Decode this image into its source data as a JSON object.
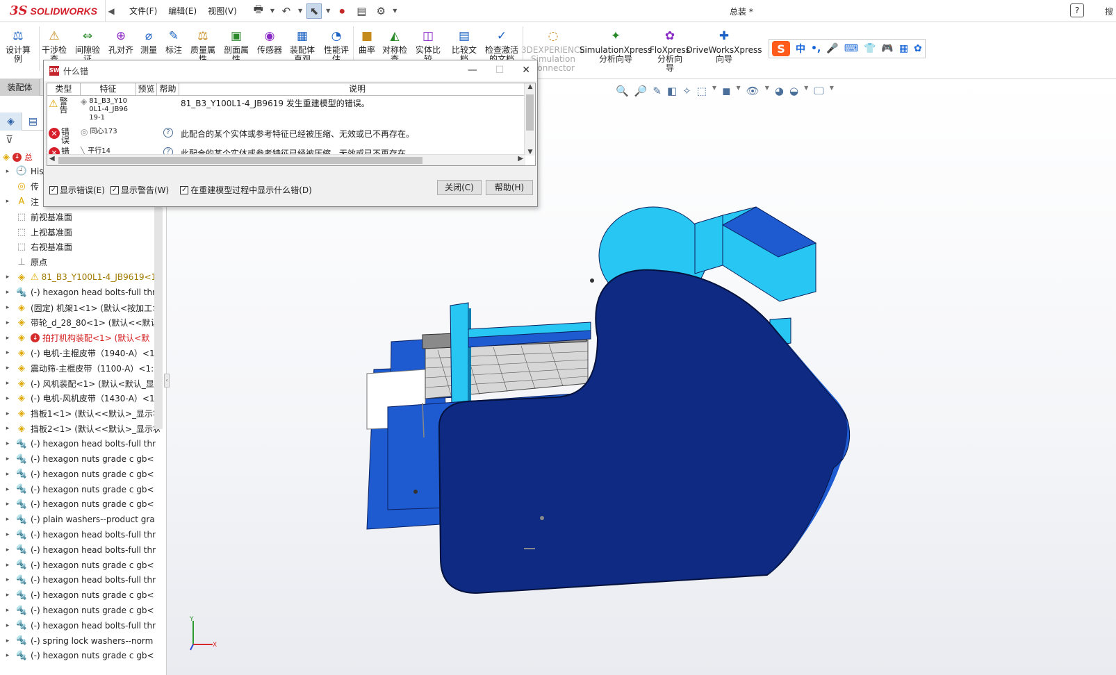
{
  "app": {
    "logo_ds": "3S",
    "logo_text": "SOLIDWORKS",
    "document_title": "总装 *",
    "help_label": "?",
    "corner_text": "搜"
  },
  "menu": [
    "文件(F)",
    "编辑(E)",
    "视图(V)"
  ],
  "ribbon": {
    "items": [
      {
        "label": "设计算\n例",
        "icon": "calculator-icon"
      },
      {
        "label": "干涉检\n查",
        "icon": "interference-icon"
      },
      {
        "label": "间隙验\n证",
        "icon": "clearance-icon"
      },
      {
        "label": "孔对齐",
        "icon": "hole-align-icon"
      },
      {
        "label": "测量",
        "icon": "measure-icon"
      },
      {
        "label": "标注",
        "icon": "markup-icon"
      },
      {
        "label": "质量属\n性",
        "icon": "mass-properties-icon"
      },
      {
        "label": "剖面属\n性",
        "icon": "section-properties-icon"
      },
      {
        "label": "传感器",
        "icon": "sensor-icon"
      },
      {
        "label": "装配体\n直观",
        "icon": "assembly-visualization-icon"
      },
      {
        "label": "性能评\n估",
        "icon": "performance-icon"
      },
      {
        "label": "曲率",
        "icon": "curvature-icon"
      },
      {
        "label": "对称检\n查",
        "icon": "symmetry-check-icon"
      },
      {
        "label": "实体比\n较",
        "icon": "body-compare-icon"
      },
      {
        "label": "比较文\n档",
        "icon": "compare-docs-icon"
      },
      {
        "label": "检查激活\n的文档",
        "icon": "check-doc-icon"
      },
      {
        "label": "3DEXPERIENCE\nSimulation\nConnector",
        "icon": "3dx-icon"
      },
      {
        "label": "SimulationXpress\n分析向导",
        "icon": "simxpress-icon"
      },
      {
        "label": "FloXpress\n分析向\n导",
        "icon": "floxpress-icon"
      },
      {
        "label": "DriveWorksXpress\n向导",
        "icon": "driveworks-icon"
      }
    ],
    "tab_label": "装配体"
  },
  "ime": {
    "s": "S",
    "items": [
      "中",
      "•,",
      "🎤",
      "⌨",
      "👕",
      "🎮",
      "▦",
      "✿"
    ]
  },
  "tree": {
    "top_label": "总",
    "rows": [
      {
        "exp": "▸",
        "icon": "history-icon",
        "label": "His",
        "kind": "normal"
      },
      {
        "exp": "",
        "icon": "sensor-icon",
        "label": "传",
        "kind": "normal"
      },
      {
        "exp": "▸",
        "icon": "annotation-icon",
        "label": "注",
        "kind": "normal"
      },
      {
        "exp": "",
        "icon": "plane-icon",
        "label": "前视基准面",
        "kind": "normal"
      },
      {
        "exp": "",
        "icon": "plane-icon",
        "label": "上视基准面",
        "kind": "normal"
      },
      {
        "exp": "",
        "icon": "plane-icon",
        "label": "右视基准面",
        "kind": "normal"
      },
      {
        "exp": "",
        "icon": "origin-icon",
        "label": "原点",
        "kind": "normal"
      },
      {
        "exp": "▸",
        "icon": "assembly-icon",
        "label": "81_B3_Y100L1-4_JB9619<1",
        "kind": "warn"
      },
      {
        "exp": "▸",
        "icon": "bolt-icon",
        "label": "(-) hexagon head bolts-full thr",
        "kind": "normal"
      },
      {
        "exp": "▸",
        "icon": "part-icon",
        "label": "(固定) 机架1<1> (默认<按加工>",
        "kind": "normal"
      },
      {
        "exp": "▸",
        "icon": "part-icon",
        "label": "带轮_d_28_80<1> (默认<<默认",
        "kind": "normal"
      },
      {
        "exp": "▸",
        "icon": "assembly-icon",
        "label": "拍打机构装配<1> (默认<默",
        "kind": "err"
      },
      {
        "exp": "▸",
        "icon": "part-icon",
        "label": "(-) 电机-主棍皮带（1940-A）<1",
        "kind": "normal"
      },
      {
        "exp": "▸",
        "icon": "part-icon",
        "label": "震动筛-主棍皮带（1100-A）<1:",
        "kind": "normal"
      },
      {
        "exp": "▸",
        "icon": "assembly-icon",
        "label": "(-) 风机装配<1> (默认<默认_显:",
        "kind": "normal"
      },
      {
        "exp": "▸",
        "icon": "part-icon",
        "label": "(-) 电机-风机皮带（1430-A）<1",
        "kind": "normal"
      },
      {
        "exp": "▸",
        "icon": "part-icon",
        "label": "挡板1<1> (默认<<默认>_显示状",
        "kind": "normal"
      },
      {
        "exp": "▸",
        "icon": "part-icon",
        "label": "挡板2<1> (默认<<默认>_显示状",
        "kind": "normal"
      },
      {
        "exp": "▸",
        "icon": "bolt-icon",
        "label": "(-) hexagon head bolts-full thr",
        "kind": "normal"
      },
      {
        "exp": "▸",
        "icon": "bolt-icon",
        "label": "(-) hexagon nuts grade c gb<",
        "kind": "normal"
      },
      {
        "exp": "▸",
        "icon": "bolt-icon",
        "label": "(-) hexagon nuts grade c gb<",
        "kind": "normal"
      },
      {
        "exp": "▸",
        "icon": "bolt-icon",
        "label": "(-) hexagon nuts grade c gb<",
        "kind": "normal"
      },
      {
        "exp": "▸",
        "icon": "bolt-icon",
        "label": "(-) hexagon nuts grade c gb<",
        "kind": "normal"
      },
      {
        "exp": "▸",
        "icon": "bolt-icon",
        "label": "(-) plain washers--product gra",
        "kind": "normal"
      },
      {
        "exp": "▸",
        "icon": "bolt-icon",
        "label": "(-) hexagon head bolts-full thr",
        "kind": "normal"
      },
      {
        "exp": "▸",
        "icon": "bolt-icon",
        "label": "(-) hexagon head bolts-full thr",
        "kind": "normal"
      },
      {
        "exp": "▸",
        "icon": "bolt-icon",
        "label": "(-) hexagon nuts grade c gb<",
        "kind": "normal"
      },
      {
        "exp": "▸",
        "icon": "bolt-icon",
        "label": "(-) hexagon head bolts-full thr",
        "kind": "normal"
      },
      {
        "exp": "▸",
        "icon": "bolt-icon",
        "label": "(-) hexagon nuts grade c gb<",
        "kind": "normal"
      },
      {
        "exp": "▸",
        "icon": "bolt-icon",
        "label": "(-) hexagon nuts grade c gb<",
        "kind": "normal"
      },
      {
        "exp": "▸",
        "icon": "bolt-icon",
        "label": "(-) hexagon head bolts-full thr",
        "kind": "normal"
      },
      {
        "exp": "▸",
        "icon": "bolt-icon",
        "label": "(-) spring lock washers--norm",
        "kind": "normal"
      },
      {
        "exp": "▸",
        "icon": "bolt-icon",
        "label": "(-) hexagon nuts grade c gb<",
        "kind": "normal"
      }
    ]
  },
  "dialog": {
    "title": "什么错",
    "columns": [
      "类型",
      "特征",
      "预览",
      "帮助",
      "说明"
    ],
    "rows": [
      {
        "type": "警告",
        "type_icon": "warning",
        "feature": "81_B3_Y10\n0L1-4_JB96\n19-1",
        "help": "",
        "desc": "81_B3_Y100L1-4_JB9619 发生重建模型的错误。"
      },
      {
        "type": "错误",
        "type_icon": "error",
        "feature": "同心173",
        "help": "?",
        "desc": "此配合的某个实体或参考特征已经被压缩、无效或已不再存在。"
      },
      {
        "type": "错误",
        "type_icon": "error",
        "feature": "平行14",
        "help": "?",
        "desc": "此配合的某个实体或参考特征已经被压缩、无效或已不再存在。"
      }
    ],
    "checkboxes": [
      {
        "label": "显示错误(E)",
        "checked": true
      },
      {
        "label": "显示警告(W)",
        "checked": true
      },
      {
        "label": "在重建模型过程中显示什么错(D)",
        "checked": true
      }
    ],
    "close_button": "关闭(C)",
    "help_button": "帮助(H)"
  },
  "triad": {
    "x": "X",
    "y": "Y"
  },
  "colors": {
    "model_dark": "#0e2a82",
    "model_mid": "#1e5bd0",
    "model_light": "#28c6f2",
    "accent_red": "#d31f2a"
  }
}
